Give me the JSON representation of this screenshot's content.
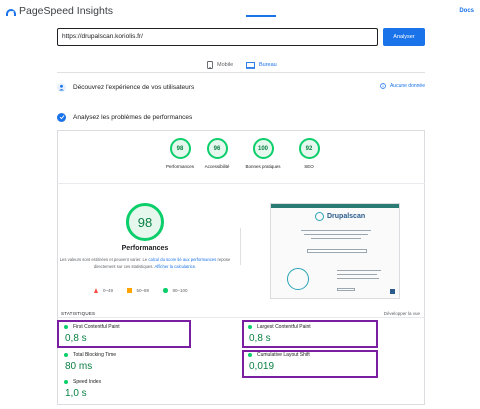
{
  "app": {
    "title": "PageSpeed Insights",
    "docs_label": "Docs"
  },
  "search": {
    "url_value": "https://drupalscan.koriolis.fr/",
    "analyze_label": "Analyser"
  },
  "tabs": [
    {
      "label": "Mobile",
      "active": false
    },
    {
      "label": "Bureau",
      "active": true
    }
  ],
  "sections": {
    "user_experience": {
      "label": "Découvrez l'expérience de vos utilisateurs",
      "no_data_label": "Aucune donnée"
    },
    "diagnose": {
      "label": "Analysez les problèmes de performances"
    }
  },
  "categories": [
    {
      "label": "Performances",
      "score": "98"
    },
    {
      "label": "Accessibilité",
      "score": "96"
    },
    {
      "label": "Bonnes pratiques",
      "score": "100"
    },
    {
      "label": "SEO",
      "score": "92"
    }
  ],
  "performance": {
    "score": "98",
    "title": "Performances",
    "desc_part1": "Les valeurs sont estimées et peuvent varier. Le ",
    "desc_link1": "calcul du score lié aux performances",
    "desc_part2": " repose directement sur ces statistiques. ",
    "desc_link2": "Afficher la calculatrice.",
    "legend": {
      "poor": "0–49",
      "average": "50–89",
      "good": "90–100"
    }
  },
  "preview": {
    "brand": "Drupalscan"
  },
  "stats": {
    "label": "STATISTIQUES",
    "expand_label": "Développer la vue",
    "metrics": [
      {
        "label": "First Contentful Paint",
        "value": "0,8 s"
      },
      {
        "label": "Largest Contentful Paint",
        "value": "0,8 s"
      },
      {
        "label": "Total Blocking Time",
        "value": "80 ms"
      },
      {
        "label": "Cumulative Layout Shift",
        "value": "0,019"
      },
      {
        "label": "Speed Index",
        "value": "1,0 s"
      }
    ]
  },
  "colors": {
    "accent": "#1a73e8",
    "good": "#0cce6b",
    "highlight": "#7b1fa2"
  }
}
